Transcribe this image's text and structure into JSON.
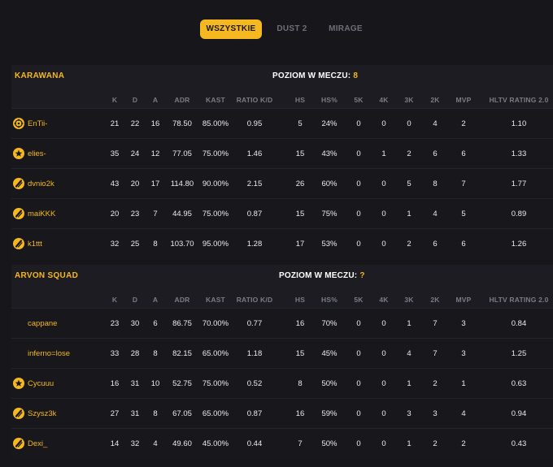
{
  "tabs": [
    {
      "label": "WSZYSTKIE",
      "active": true
    },
    {
      "label": "DUST 2",
      "active": false
    },
    {
      "label": "MIRAGE",
      "active": false
    }
  ],
  "columns": [
    "K",
    "D",
    "A",
    "ADR",
    "KAST",
    "RATIO K/D",
    "HS",
    "HS%",
    "5K",
    "4K",
    "3K",
    "2K",
    "MVP",
    "HLTV RATING 2.0"
  ],
  "level_label": "POZIOM W MECZU:",
  "teams": [
    {
      "name": "KARAWANA",
      "level": "8",
      "players": [
        {
          "name": "EnTii-",
          "icon": "crosshair-icon",
          "stats": [
            "21",
            "22",
            "16",
            "78.50",
            "85.00%",
            "0.95",
            "5",
            "24%",
            "0",
            "0",
            "0",
            "4",
            "2",
            "1.10"
          ]
        },
        {
          "name": "elies-",
          "icon": "star-icon",
          "stats": [
            "35",
            "24",
            "12",
            "77.05",
            "75.00%",
            "1.46",
            "15",
            "43%",
            "0",
            "1",
            "2",
            "6",
            "6",
            "1.33"
          ]
        },
        {
          "name": "dvnio2k",
          "icon": "slash-icon",
          "stats": [
            "43",
            "20",
            "17",
            "114.80",
            "90.00%",
            "2.15",
            "26",
            "60%",
            "0",
            "0",
            "5",
            "8",
            "7",
            "1.77"
          ]
        },
        {
          "name": "maiKKK",
          "icon": "slash-icon",
          "stats": [
            "20",
            "23",
            "7",
            "44.95",
            "75.00%",
            "0.87",
            "15",
            "75%",
            "0",
            "0",
            "1",
            "4",
            "5",
            "0.89"
          ]
        },
        {
          "name": "k1ttt",
          "icon": "slash-icon",
          "stats": [
            "32",
            "25",
            "8",
            "103.70",
            "95.00%",
            "1.28",
            "17",
            "53%",
            "0",
            "0",
            "2",
            "6",
            "6",
            "1.26"
          ]
        }
      ]
    },
    {
      "name": "ARVON SQUAD",
      "level": "?",
      "players": [
        {
          "name": "cappane",
          "icon": "",
          "stats": [
            "23",
            "30",
            "6",
            "86.75",
            "70.00%",
            "0.77",
            "16",
            "70%",
            "0",
            "0",
            "1",
            "7",
            "3",
            "0.84"
          ]
        },
        {
          "name": "inferno=lose",
          "icon": "",
          "stats": [
            "33",
            "28",
            "8",
            "82.15",
            "65.00%",
            "1.18",
            "15",
            "45%",
            "0",
            "0",
            "4",
            "7",
            "3",
            "1.25"
          ]
        },
        {
          "name": "Cycuuu",
          "icon": "star-icon",
          "stats": [
            "16",
            "31",
            "10",
            "52.75",
            "75.00%",
            "0.52",
            "8",
            "50%",
            "0",
            "0",
            "1",
            "2",
            "1",
            "0.63"
          ]
        },
        {
          "name": "Szysz3k",
          "icon": "slash-icon",
          "stats": [
            "27",
            "31",
            "8",
            "67.05",
            "65.00%",
            "0.87",
            "16",
            "59%",
            "0",
            "0",
            "3",
            "3",
            "4",
            "0.94"
          ]
        },
        {
          "name": "Dexi_",
          "icon": "slash-icon",
          "stats": [
            "14",
            "32",
            "4",
            "49.60",
            "45.00%",
            "0.44",
            "7",
            "50%",
            "0",
            "0",
            "1",
            "2",
            "2",
            "0.43"
          ]
        }
      ]
    }
  ]
}
